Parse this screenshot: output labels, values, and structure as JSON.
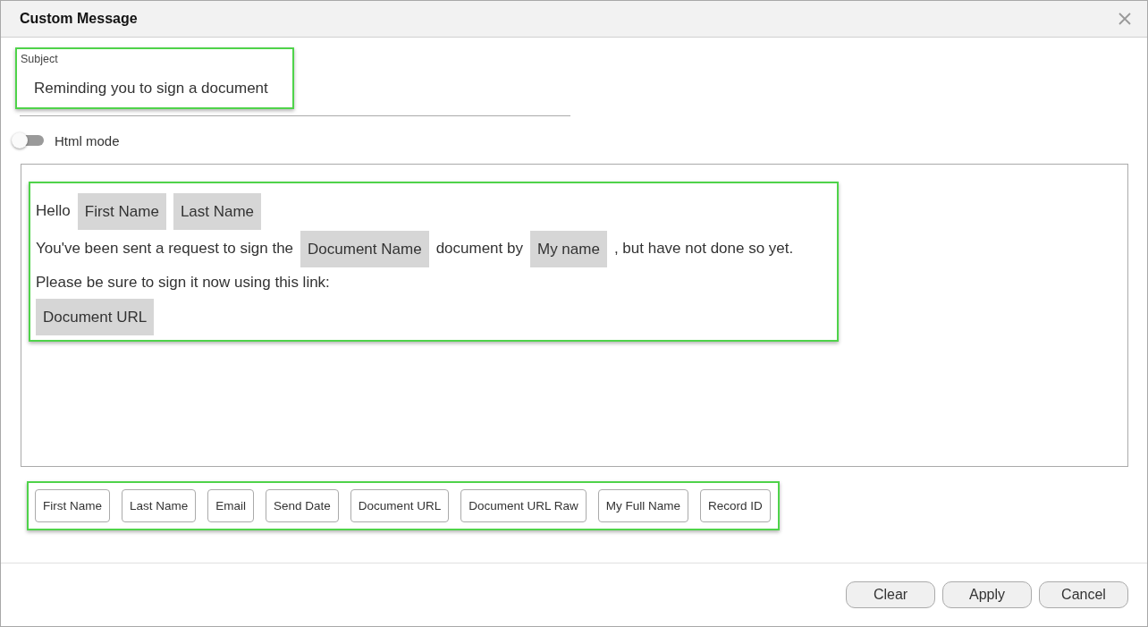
{
  "window": {
    "title": "Custom Message"
  },
  "subject": {
    "label": "Subject",
    "value": "Reminding you to sign a document"
  },
  "html_mode": {
    "label": "Html mode",
    "on": false
  },
  "message_lines": [
    [
      {
        "kind": "text",
        "text": "Hello"
      },
      {
        "kind": "token",
        "text": "First Name"
      },
      {
        "kind": "token",
        "text": "Last Name"
      }
    ],
    [
      {
        "kind": "text",
        "text": "You've been sent a request to sign the"
      },
      {
        "kind": "token",
        "text": "Document Name"
      },
      {
        "kind": "text",
        "text": "document by"
      },
      {
        "kind": "token",
        "text": "My name"
      },
      {
        "kind": "text",
        "text": ", but have not done so yet."
      }
    ],
    [
      {
        "kind": "text",
        "text": "Please be sure to sign it now using this link:"
      }
    ],
    [
      {
        "kind": "token",
        "text": "Document URL"
      }
    ]
  ],
  "placeholders": [
    "First Name",
    "Last Name",
    "Email",
    "Send Date",
    "Document URL",
    "Document URL Raw",
    "My Full Name",
    "Record ID"
  ],
  "buttons": [
    "Clear",
    "Apply",
    "Cancel"
  ]
}
